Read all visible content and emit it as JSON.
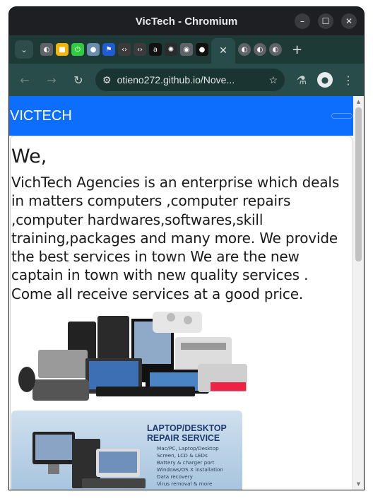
{
  "window": {
    "title": "VicTech - Chromium",
    "minimize_glyph": "–",
    "maximize_glyph": "☐",
    "close_glyph": "✕"
  },
  "tabs": {
    "menu_glyph": "⌄",
    "active_close_glyph": "✕",
    "new_tab_glyph": "+",
    "icons": [
      {
        "name": "globe-icon",
        "glyph": "◐",
        "bg": "#5f6368"
      },
      {
        "name": "tab-favicon-yellow",
        "glyph": "■",
        "bg": "#f2b705"
      },
      {
        "name": "tab-favicon-green-power",
        "glyph": "⏻",
        "bg": "#2ecc40"
      },
      {
        "name": "tab-favicon-avatar",
        "glyph": "●",
        "bg": "#6a8caf"
      },
      {
        "name": "flag-icon",
        "glyph": "⚑",
        "bg": "#1e5bd6"
      },
      {
        "name": "code-icon",
        "glyph": "‹›",
        "bg": "#3b3b3b"
      },
      {
        "name": "code-icon-orange",
        "glyph": "‹›",
        "bg": "#3b3b3b"
      },
      {
        "name": "amazon-icon",
        "glyph": "a",
        "bg": "#111111"
      },
      {
        "name": "openai-icon",
        "glyph": "✺",
        "bg": "#2b2b2b"
      },
      {
        "name": "chromium-icon",
        "glyph": "◉",
        "bg": "#5f6368"
      },
      {
        "name": "github-icon",
        "glyph": "●",
        "bg": "#111111"
      }
    ],
    "trailing_icons": [
      {
        "name": "globe-icon-2",
        "glyph": "◐"
      },
      {
        "name": "globe-icon-3",
        "glyph": "◐"
      },
      {
        "name": "globe-icon-4",
        "glyph": "◐"
      }
    ]
  },
  "toolbar": {
    "back_glyph": "←",
    "forward_glyph": "→",
    "reload_glyph": "↻",
    "site_info_glyph": "⚙",
    "url": "otieno272.github.io/Nove...",
    "star_glyph": "☆",
    "labs_glyph": "⚗",
    "profile_glyph": "●",
    "menu_glyph": "⋮"
  },
  "page": {
    "brand": "VICTECH",
    "heading": "We,",
    "paragraph": "VichTech Agencies is an enterprise which deals in matters computers ,computer repairs ,computer hardwares,softwares,skill training,packages and many more. We provide the best services in town We are the new captain in town with new quality services . Come all receive services at a good price.",
    "repair_title_line1": "LAPTOP/DESKTOP",
    "repair_title_line2": "REPAIR SERVICE",
    "repair_items": [
      "Mac/PC, Laptop/Desktop",
      "Screen, LCD & LEDs",
      "Battery & charger port",
      "Windows/OS X installation",
      "Data recovery",
      "Virus removal & more"
    ]
  },
  "colors": {
    "navbar": "#0d6efd",
    "tabstrip": "#1d3a37",
    "toolbar": "#284c49"
  }
}
